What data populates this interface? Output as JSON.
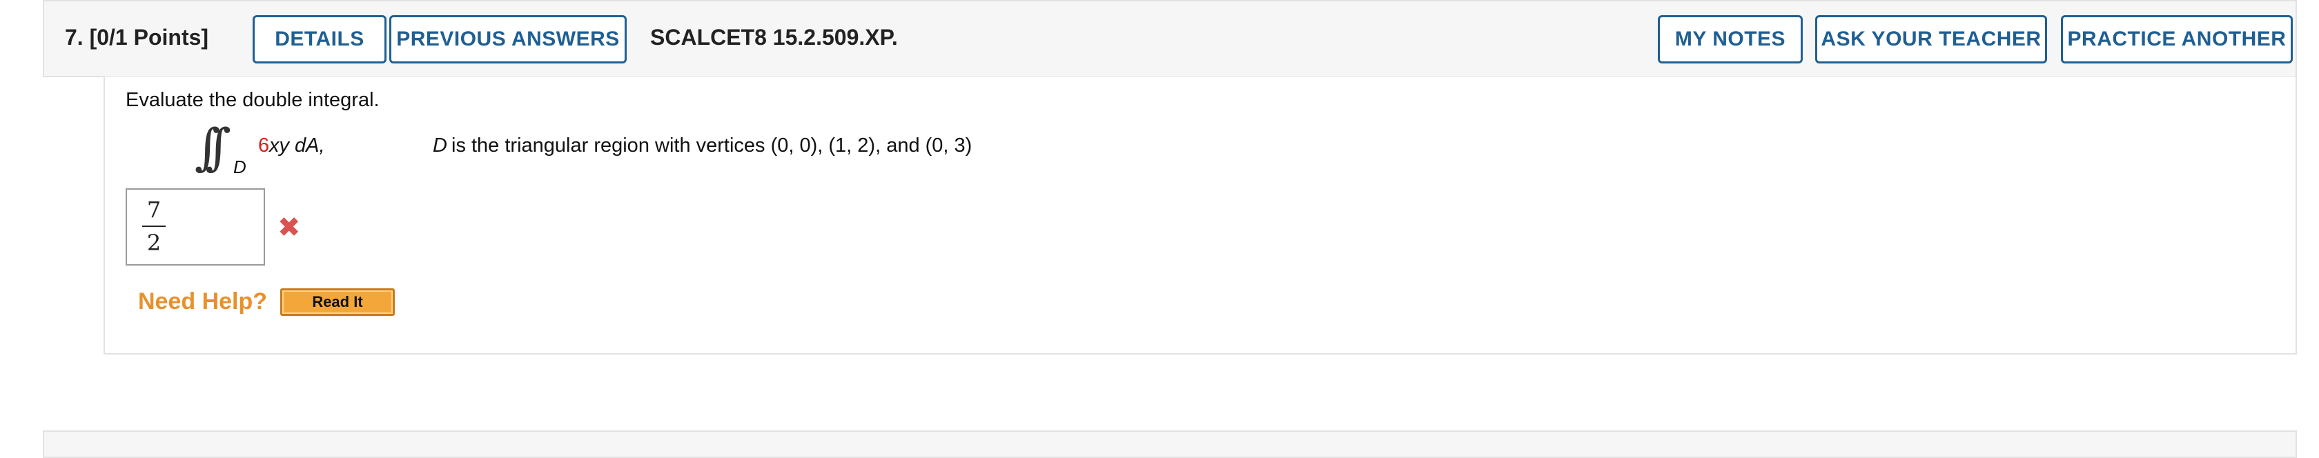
{
  "question": {
    "number_points": "7. [0/1 Points]",
    "buttons": {
      "details": "DETAILS",
      "previous_answers": "PREVIOUS ANSWERS",
      "my_notes": "MY NOTES",
      "ask_teacher": "ASK YOUR TEACHER",
      "practice_another": "PRACTICE ANOTHER"
    },
    "code": "SCALCET8 15.2.509.XP.",
    "prompt": "Evaluate the double integral.",
    "integral": {
      "symbol": "∫∫",
      "subscript": "D",
      "coefficient": "6",
      "integrand": "xy dA,",
      "region_var": "D",
      "region_text": " is the triangular region with vertices (0, 0), (1, 2), and (0, 3)"
    },
    "answer": {
      "numerator": "7",
      "denominator": "2",
      "status": "incorrect",
      "status_icon": "✖"
    },
    "help": {
      "label": "Need Help?",
      "read_it": "Read It"
    }
  },
  "colors": {
    "button_border": "#1f5f93",
    "accent_orange": "#e8912c",
    "wrong_red": "#d9534f",
    "coefficient_red": "#d61f1f"
  }
}
